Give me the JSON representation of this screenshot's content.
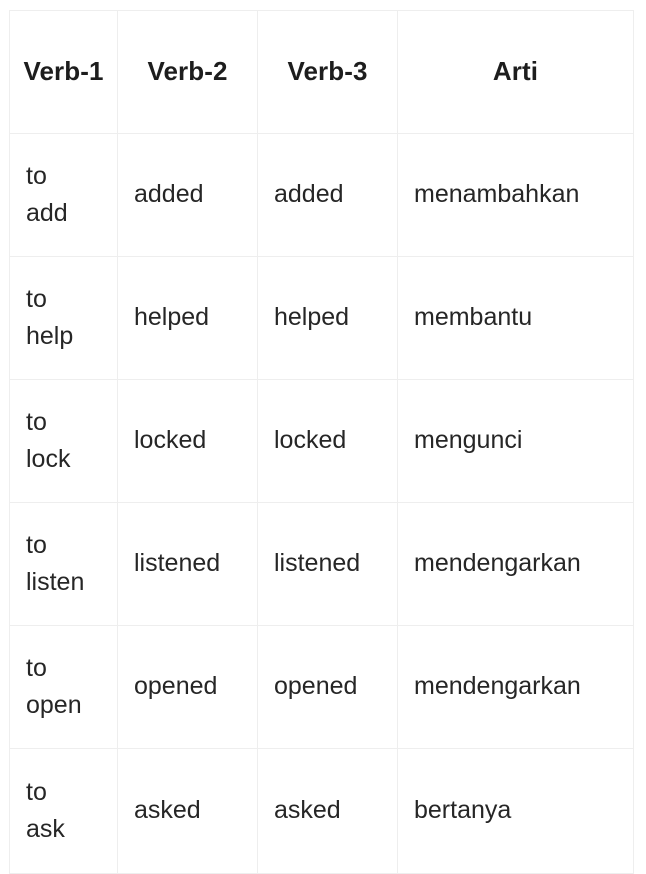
{
  "table": {
    "name": "irregular-verb-forms-table",
    "headers": [
      "Verb-1",
      "Verb-2",
      "Verb-3",
      "Arti"
    ],
    "rows": [
      {
        "verb1": "to add",
        "verb2": "added",
        "verb3": "added",
        "arti": "menambahkan"
      },
      {
        "verb1": "to help",
        "verb2": "helped",
        "verb3": "helped",
        "arti": "membantu"
      },
      {
        "verb1": "to lock",
        "verb2": "locked",
        "verb3": "locked",
        "arti": "mengunci"
      },
      {
        "verb1": "to listen",
        "verb2": "listened",
        "verb3": "listened",
        "arti": "mendengarkan"
      },
      {
        "verb1": "to open",
        "verb2": "opened",
        "verb3": "opened",
        "arti": "mendengarkan"
      },
      {
        "verb1": "to ask",
        "verb2": "asked",
        "verb3": "asked",
        "arti": "bertanya"
      }
    ]
  },
  "colors": {
    "page_background": "#ffffff",
    "cell_background": "#ffffff",
    "border": "#eeeeee",
    "header_text": "#1d1d1d",
    "body_text": "#262626"
  }
}
